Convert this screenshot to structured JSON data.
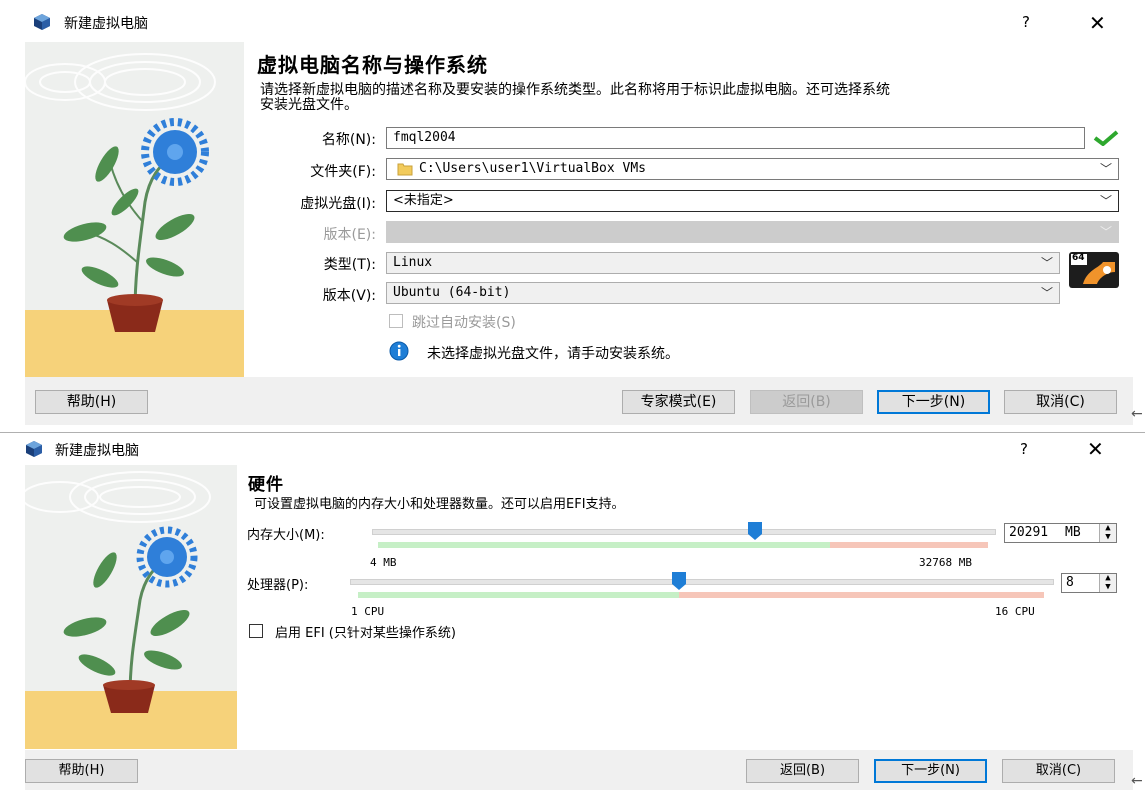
{
  "dialog1": {
    "title": "新建虚拟电脑",
    "help": "?",
    "close": "✕",
    "heading": "虚拟电脑名称与操作系统",
    "description_line1": "请选择新虚拟电脑的描述名称及要安装的操作系统类型。此名称将用于标识此虚拟电脑。还可选择系统",
    "description_line2": "安装光盘文件。",
    "fields": {
      "name_label": "名称(N):",
      "name_value": "fmql2004",
      "folder_label": "文件夹(F):",
      "folder_value": "C:\\Users\\user1\\VirtualBox VMs",
      "iso_label": "虚拟光盘(I):",
      "iso_value": "<未指定>",
      "edition_label": "版本(E):",
      "edition_value": "",
      "type_label": "类型(T):",
      "type_value": "Linux",
      "version_label": "版本(V):",
      "version_value": "Ubuntu (64-bit)",
      "skip_unattended_label": "跳过自动安装(S)",
      "os_badge": "64"
    },
    "info_message": "未选择虚拟光盘文件，请手动安装系统。",
    "buttons": {
      "help": "帮助(H)",
      "expert": "专家模式(E)",
      "back": "返回(B)",
      "next": "下一步(N)",
      "cancel": "取消(C)"
    }
  },
  "dialog2": {
    "title": "新建虚拟电脑",
    "help": "?",
    "close": "✕",
    "heading": "硬件",
    "description": "可设置虚拟电脑的内存大小和处理器数量。还可以启用EFI支持。",
    "memory": {
      "label": "内存大小(M):",
      "value": "20291",
      "unit": "MB",
      "min_label": "4 MB",
      "max_label": "32768 MB",
      "fraction": 0.62
    },
    "cpu": {
      "label": "处理器(P):",
      "value": "8",
      "min_label": "1 CPU",
      "max_label": "16 CPU",
      "fraction": 0.467
    },
    "efi_label": "启用 EFI (只针对某些操作系统)",
    "buttons": {
      "help": "帮助(H)",
      "back": "返回(B)",
      "next": "下一步(N)",
      "cancel": "取消(C)"
    }
  },
  "side_arrow": "←",
  "colors": {
    "accent": "#0078d7",
    "slider_green": "#c6efc6",
    "slider_red": "#f6c6b9",
    "thumb": "#1f7ed6"
  }
}
